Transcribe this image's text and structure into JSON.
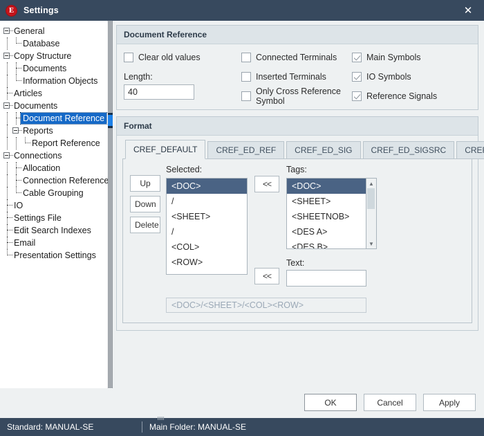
{
  "window": {
    "title": "Settings",
    "logo_letter": "E",
    "close_label": "✕",
    "accent_title_bg": "#37495e",
    "accent_selection": "#1569c7",
    "accent_list_selection": "#4a6384",
    "logo_color": "#c4151c"
  },
  "sidebar": {
    "items": [
      {
        "label": "General",
        "level": 0,
        "expandable": true
      },
      {
        "label": "Database",
        "level": 1,
        "expandable": false
      },
      {
        "label": "Copy Structure",
        "level": 0,
        "expandable": true
      },
      {
        "label": "Documents",
        "level": 1,
        "expandable": false
      },
      {
        "label": "Information Objects",
        "level": 1,
        "expandable": false
      },
      {
        "label": "Articles",
        "level": 0,
        "expandable": false
      },
      {
        "label": "Documents",
        "level": 0,
        "expandable": true
      },
      {
        "label": "Document Reference",
        "level": 1,
        "expandable": false,
        "selected": true
      },
      {
        "label": "Reports",
        "level": 1,
        "expandable": true
      },
      {
        "label": "Report Reference",
        "level": 2,
        "expandable": false
      },
      {
        "label": "Connections",
        "level": 0,
        "expandable": true
      },
      {
        "label": "Allocation",
        "level": 1,
        "expandable": false
      },
      {
        "label": "Connection Reference",
        "level": 1,
        "expandable": false
      },
      {
        "label": "Cable Grouping",
        "level": 1,
        "expandable": false
      },
      {
        "label": "IO",
        "level": 0,
        "expandable": false
      },
      {
        "label": "Settings File",
        "level": 0,
        "expandable": false
      },
      {
        "label": "Edit Search Indexes",
        "level": 0,
        "expandable": false
      },
      {
        "label": "Email",
        "level": 0,
        "expandable": false
      },
      {
        "label": "Presentation Settings",
        "level": 0,
        "expandable": false
      }
    ]
  },
  "document_reference": {
    "title": "Document Reference",
    "checkboxes": {
      "connected_terminals": {
        "label": "Connected Terminals",
        "checked": false
      },
      "inserted_terminals": {
        "label": "Inserted Terminals",
        "checked": false
      },
      "only_cross_reference_symbol": {
        "label": "Only Cross Reference Symbol",
        "checked": false
      },
      "main_symbols": {
        "label": "Main Symbols",
        "checked": true
      },
      "io_symbols": {
        "label": "IO Symbols",
        "checked": true
      },
      "reference_signals": {
        "label": "Reference Signals",
        "checked": true
      },
      "clear_old_values": {
        "label": "Clear old values",
        "checked": false
      }
    },
    "length": {
      "label": "Length:",
      "value": "40",
      "placeholder": ""
    }
  },
  "format": {
    "title": "Format",
    "tabs": [
      {
        "label": "CREF_DEFAULT",
        "active": true
      },
      {
        "label": "CREF_ED_REF",
        "active": false
      },
      {
        "label": "CREF_ED_SIG",
        "active": false
      },
      {
        "label": "CREF_ED_SIGSRC",
        "active": false
      },
      {
        "label": "CREF_ED_SIGSINK",
        "active": false
      }
    ],
    "buttons": {
      "up": "Up",
      "down": "Down",
      "delete": "Delete"
    },
    "selected": {
      "label": "Selected:",
      "items": [
        "<DOC>",
        "/",
        "<SHEET>",
        "/",
        "<COL>",
        "<ROW>"
      ],
      "selected_index": 0
    },
    "tags": {
      "label": "Tags:",
      "items": [
        "<DOC>",
        "<SHEET>",
        "<SHEETNOB>",
        "<DES A>",
        "<DES B>"
      ],
      "selected_index": 0
    },
    "transfer_tag_label": "<<",
    "transfer_text_label": "<<",
    "text": {
      "label": "Text:",
      "value": "",
      "placeholder": ""
    },
    "preview": "<DOC>/<SHEET>/<COL><ROW>"
  },
  "footer": {
    "ok": "OK",
    "cancel": "Cancel",
    "apply": "Apply"
  },
  "statusbar": {
    "standard": "Standard: MANUAL-SE",
    "main_folder": "Main Folder: MANUAL-SE"
  }
}
